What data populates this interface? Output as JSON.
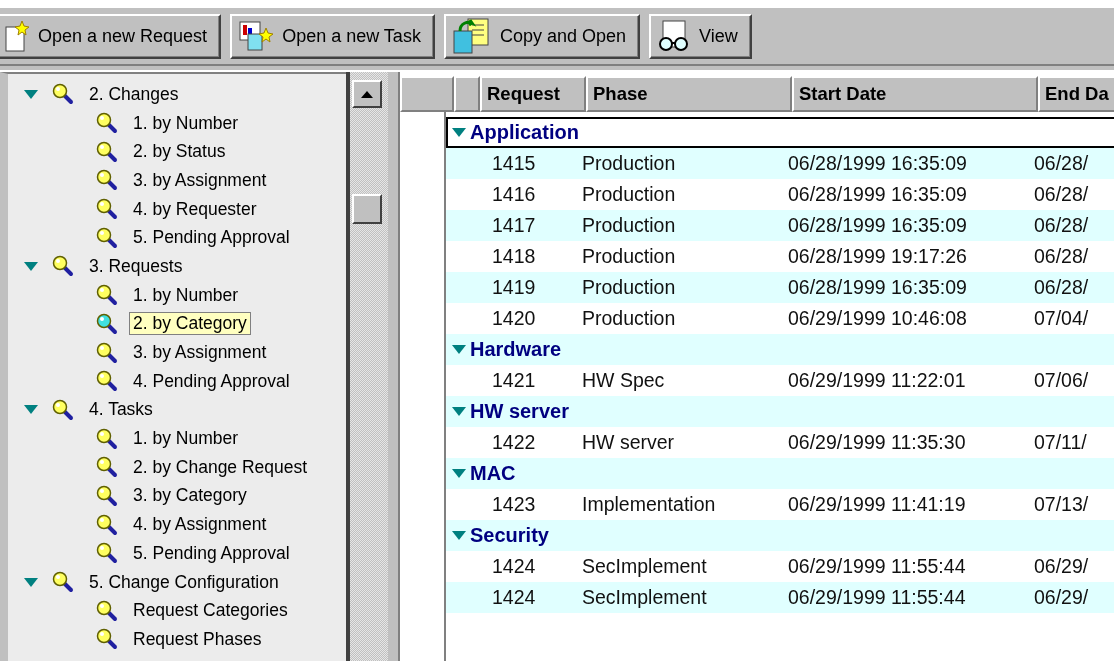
{
  "toolbar": [
    {
      "label": "Open a new Request",
      "kind": "new-request"
    },
    {
      "label": "Open a  new Task",
      "kind": "new-task"
    },
    {
      "label": "Copy and Open",
      "kind": "copy"
    },
    {
      "label": "View",
      "kind": "view"
    }
  ],
  "tree": [
    {
      "label": "2. Changes",
      "expanded": true,
      "selected": false,
      "children": [
        {
          "label": "1. by Number",
          "selected": false
        },
        {
          "label": "2. by Status",
          "selected": false
        },
        {
          "label": "3. by Assignment",
          "selected": false
        },
        {
          "label": "4. by Requester",
          "selected": false
        },
        {
          "label": "5. Pending Approval",
          "selected": false
        }
      ]
    },
    {
      "label": "3. Requests",
      "expanded": true,
      "selected": false,
      "children": [
        {
          "label": "1. by Number",
          "selected": false
        },
        {
          "label": "2. by Category",
          "selected": true
        },
        {
          "label": "3. by Assignment",
          "selected": false
        },
        {
          "label": "4. Pending Approval",
          "selected": false
        }
      ]
    },
    {
      "label": "4. Tasks",
      "expanded": true,
      "selected": false,
      "children": [
        {
          "label": "1. by Number",
          "selected": false
        },
        {
          "label": "2. by Change Request",
          "selected": false
        },
        {
          "label": "3. by Category",
          "selected": false
        },
        {
          "label": "4. by Assignment",
          "selected": false
        },
        {
          "label": "5. Pending Approval",
          "selected": false
        }
      ]
    },
    {
      "label": "5. Change Configuration",
      "expanded": true,
      "selected": false,
      "children": [
        {
          "label": "Request Categories",
          "selected": false
        },
        {
          "label": "Request Phases",
          "selected": false
        }
      ]
    }
  ],
  "table": {
    "columns": [
      "Request",
      "Phase",
      "Start Date",
      "End Da"
    ],
    "groups": [
      {
        "name": "Application",
        "expanded": true,
        "focused": true,
        "rows": [
          [
            "1415",
            "Production",
            "06/28/1999 16:35:09",
            "06/28/"
          ],
          [
            "1416",
            "Production",
            "06/28/1999 16:35:09",
            "06/28/"
          ],
          [
            "1417",
            "Production",
            "06/28/1999 16:35:09",
            "06/28/"
          ],
          [
            "1418",
            "Production",
            "06/28/1999 19:17:26",
            "06/28/"
          ],
          [
            "1419",
            "Production",
            "06/28/1999 16:35:09",
            "06/28/"
          ],
          [
            "1420",
            "Production",
            "06/29/1999 10:46:08",
            "07/04/"
          ]
        ]
      },
      {
        "name": "Hardware",
        "expanded": true,
        "focused": false,
        "rows": [
          [
            "1421",
            "HW Spec",
            "06/29/1999 11:22:01",
            "07/06/"
          ]
        ]
      },
      {
        "name": "HW server",
        "expanded": true,
        "focused": false,
        "rows": [
          [
            "1422",
            "HW server",
            "06/29/1999 11:35:30",
            "07/11/"
          ]
        ]
      },
      {
        "name": "MAC",
        "expanded": true,
        "focused": false,
        "rows": [
          [
            "1423",
            "Implementation",
            "06/29/1999 11:41:19",
            "07/13/"
          ]
        ]
      },
      {
        "name": "Security",
        "expanded": true,
        "focused": false,
        "rows": [
          [
            "1424",
            "SecImplement",
            "06/29/1999 11:55:44",
            "06/29/"
          ],
          [
            "1424",
            "SecImplement",
            "06/29/1999 11:55:44",
            "06/29/"
          ]
        ]
      }
    ]
  }
}
